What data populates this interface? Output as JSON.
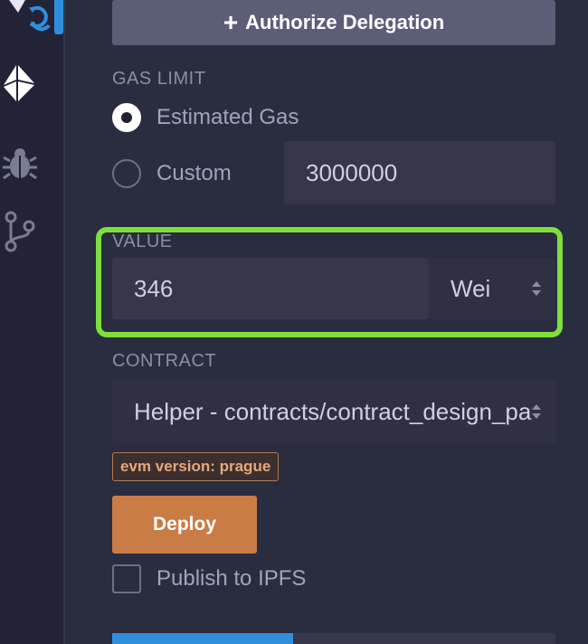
{
  "sidebar": {
    "icons": [
      {
        "name": "deploy-run-icon",
        "active": true
      },
      {
        "name": "ethereum-icon"
      },
      {
        "name": "debugger-bug-icon"
      },
      {
        "name": "git-branch-icon"
      }
    ]
  },
  "delegation": {
    "button_label": "Authorize Delegation",
    "plus": "+"
  },
  "gas_limit": {
    "label": "GAS LIMIT",
    "options": [
      {
        "label": "Estimated Gas",
        "checked": true
      },
      {
        "label": "Custom",
        "checked": false
      }
    ],
    "custom_value": "3000000"
  },
  "value": {
    "label": "VALUE",
    "amount": "346",
    "unit": "Wei"
  },
  "contract": {
    "label": "CONTRACT",
    "selected": "Helper - contracts/contract_design_patterns.sol"
  },
  "evm_badge": "evm version: prague",
  "deploy": {
    "button_label": "Deploy"
  },
  "publish": {
    "label": "Publish to IPFS",
    "checked": false
  },
  "colors": {
    "accent_blue": "#2f8fdd",
    "deploy_orange": "#c97c45",
    "highlight_green": "#7ddf3b"
  }
}
